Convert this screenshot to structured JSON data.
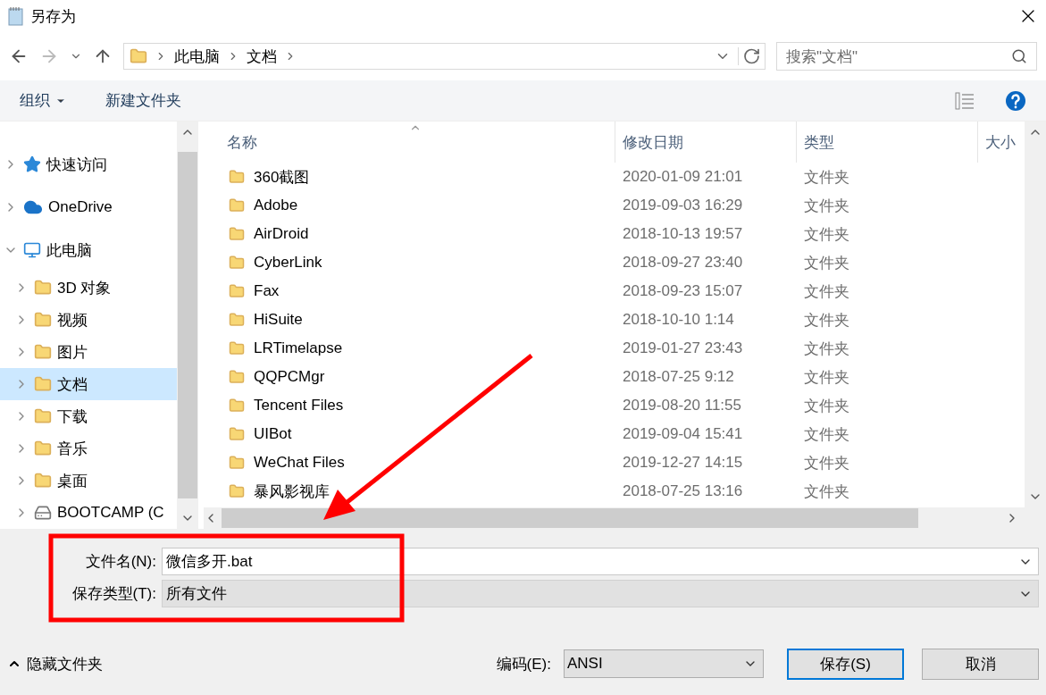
{
  "window": {
    "title": "另存为"
  },
  "address_bar": {
    "path": [
      "此电脑",
      "文档"
    ]
  },
  "search": {
    "placeholder": "搜索\"文档\""
  },
  "toolbar": {
    "organize": "组织",
    "new_folder": "新建文件夹"
  },
  "sidebar": {
    "items": [
      {
        "label": "快速访问",
        "kind": "star",
        "expanded": false,
        "selected": false
      },
      {
        "label": "OneDrive",
        "kind": "cloud",
        "expanded": false,
        "selected": false
      },
      {
        "label": "此电脑",
        "kind": "pc",
        "expanded": true,
        "selected": false,
        "children": [
          {
            "label": "3D 对象",
            "kind": "folder",
            "expanded": false,
            "selected": false
          },
          {
            "label": "视频",
            "kind": "folder",
            "expanded": false,
            "selected": false
          },
          {
            "label": "图片",
            "kind": "folder",
            "expanded": false,
            "selected": false
          },
          {
            "label": "文档",
            "kind": "folder",
            "expanded": false,
            "selected": true
          },
          {
            "label": "下载",
            "kind": "folder",
            "expanded": false,
            "selected": false
          },
          {
            "label": "音乐",
            "kind": "folder",
            "expanded": false,
            "selected": false
          },
          {
            "label": "桌面",
            "kind": "folder",
            "expanded": false,
            "selected": false
          },
          {
            "label": "BOOTCAMP (C",
            "kind": "drive",
            "expanded": false,
            "selected": false
          }
        ]
      }
    ]
  },
  "file_list": {
    "columns": [
      "名称",
      "修改日期",
      "类型",
      "大小"
    ],
    "rows": [
      {
        "name": "360截图",
        "modified": "2020-01-09 21:01",
        "type": "文件夹"
      },
      {
        "name": "Adobe",
        "modified": "2019-09-03 16:29",
        "type": "文件夹"
      },
      {
        "name": "AirDroid",
        "modified": "2018-10-13 19:57",
        "type": "文件夹"
      },
      {
        "name": "CyberLink",
        "modified": "2018-09-27 23:40",
        "type": "文件夹"
      },
      {
        "name": "Fax",
        "modified": "2018-09-23 15:07",
        "type": "文件夹"
      },
      {
        "name": "HiSuite",
        "modified": "2018-10-10 1:14",
        "type": "文件夹"
      },
      {
        "name": "LRTimelapse",
        "modified": "2019-01-27 23:43",
        "type": "文件夹"
      },
      {
        "name": "QQPCMgr",
        "modified": "2018-07-25 9:12",
        "type": "文件夹"
      },
      {
        "name": "Tencent Files",
        "modified": "2019-08-20 11:55",
        "type": "文件夹"
      },
      {
        "name": "UIBot",
        "modified": "2019-09-04 15:41",
        "type": "文件夹"
      },
      {
        "name": "WeChat Files",
        "modified": "2019-12-27 14:15",
        "type": "文件夹"
      },
      {
        "name": "暴风影视库",
        "modified": "2018-07-25 13:16",
        "type": "文件夹"
      }
    ]
  },
  "form": {
    "filename_label": "文件名(N):",
    "filename": "微信多开.bat",
    "type_label": "保存类型(T):",
    "type": "所有文件"
  },
  "footer": {
    "hide_folders": "隐藏文件夹",
    "encoding_label": "编码(E):",
    "encoding": "ANSI",
    "buttons": [
      "保存(S)",
      "取消"
    ]
  }
}
